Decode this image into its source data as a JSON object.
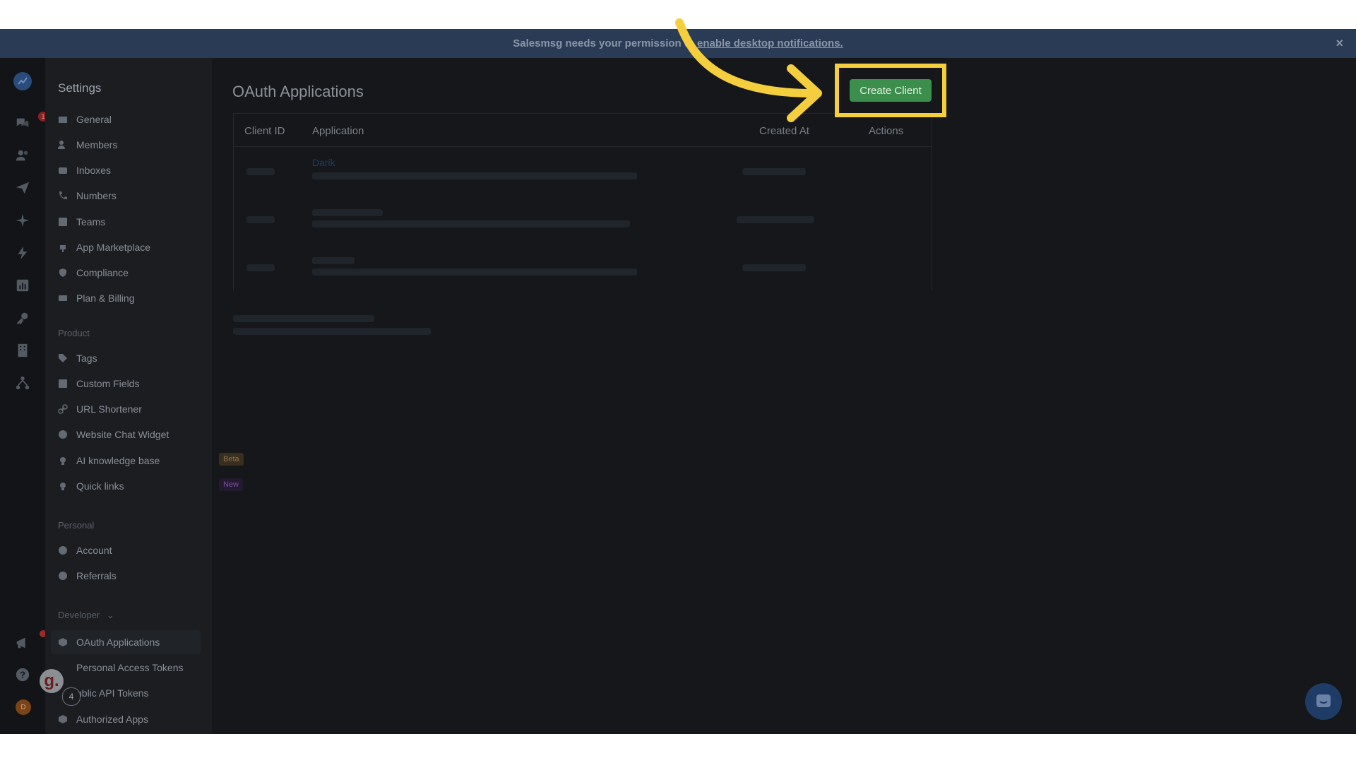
{
  "banner": {
    "text": "Salesmsg needs your permission to",
    "link": "enable desktop notifications.",
    "close": "×"
  },
  "rail": {
    "icons": [
      "logo-icon",
      "conversations-icon",
      "contacts-icon",
      "send-icon",
      "sparkle-icon",
      "automation-icon",
      "analytics-icon",
      "key-icon",
      "building-icon",
      "integrations-icon"
    ],
    "notification_count": "1",
    "avatar_initial": "D"
  },
  "sidebar": {
    "title": "Settings",
    "general_items": [
      "General",
      "Members",
      "Inboxes",
      "Numbers",
      "Teams",
      "App Marketplace",
      "Compliance",
      "Plan & Billing"
    ],
    "product_label": "Product",
    "product_items": [
      "Tags",
      "Custom Fields",
      "URL Shortener",
      "Website Chat Widget",
      "AI knowledge base",
      "Quick links"
    ],
    "beta_tag": "Beta",
    "new_tag": "New",
    "personal_label": "Personal",
    "personal_items": [
      "Account",
      "Referrals"
    ],
    "developer_label": "Developer",
    "developer_items": [
      "OAuth Applications",
      "Personal Access Tokens",
      "ublic API Tokens",
      "Authorized Apps"
    ]
  },
  "overlay": {
    "g_logo": "g.",
    "step_number": "4"
  },
  "main": {
    "title": "OAuth Applications",
    "create_button": "Create Client",
    "table": {
      "columns": [
        "Client ID",
        "Application",
        "Created At",
        "Actions"
      ],
      "first_app": "Darik"
    }
  },
  "colors": {
    "accent_green": "#3b8e4b",
    "highlight_yellow": "#f5ce3e",
    "banner_bg": "#2a3b55"
  }
}
